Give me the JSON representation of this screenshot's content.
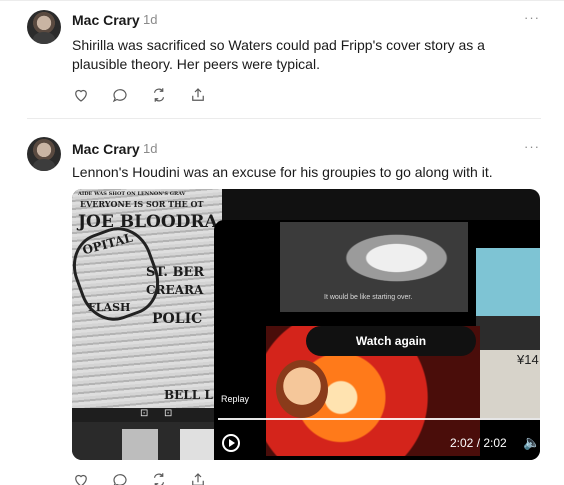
{
  "posts": [
    {
      "author": "Mac Crary",
      "time": "1d",
      "more": "···",
      "text": "Shirilla was sacrificed so Waters could pad Fripp's cover story as a plausible theory.  Her peers were typical."
    },
    {
      "author": "Mac Crary",
      "time": "1d",
      "more": "···",
      "text": "Lennon's Houdini was an excuse for his groupies to go along with it.",
      "media": {
        "newsclip_lines": [
          "AIDE WAS SHOT ON LENNON'S GRAV",
          "EVERYONE IS SOR THE OT",
          "JOE BLOODRA",
          "OPITAL",
          "ST. BER",
          "CREARA",
          "FLASH",
          "POLIC",
          "BELL L"
        ],
        "video_caption": "It would be like starting over.",
        "price_text": "¥14",
        "watch_again_label": "Watch again",
        "replay_label": "Replay",
        "duration": "2:02 / 2:02"
      }
    }
  ],
  "icons": [
    "reply-icon",
    "comment-icon",
    "repost-icon",
    "share-icon",
    "replay-icon",
    "volume-icon",
    "more-icon"
  ]
}
